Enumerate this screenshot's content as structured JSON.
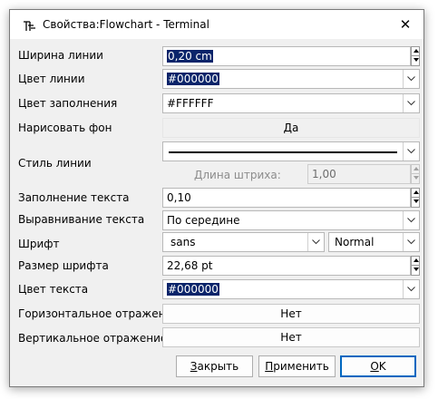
{
  "window": {
    "title": "Свойства:Flowchart - Terminal",
    "close_glyph": "✕"
  },
  "labels": {
    "line_width": "Ширина линии",
    "line_color": "Цвет линии",
    "fill_color": "Цвет заполнения",
    "draw_background": "Нарисовать фон",
    "line_style": "Стиль линии",
    "dash_length": "Длина штриха:",
    "text_padding": "Заполнение текста",
    "text_alignment": "Выравнивание текста",
    "font": "Шрифт",
    "font_size": "Размер шрифта",
    "text_color": "Цвет текста",
    "flip_horizontal": "Горизонтальное отражение",
    "flip_vertical": "Вертикальное отражение"
  },
  "values": {
    "line_width": "0,20 cm",
    "line_color": "#000000",
    "fill_color": "#FFFFFF",
    "draw_background": "Да",
    "dash_length": "1,00",
    "text_padding": "0,10",
    "text_alignment": "По середине",
    "font_family": "sans",
    "font_style": "Normal",
    "font_size": "22,68 pt",
    "text_color": "#000000",
    "flip_horizontal": "Нет",
    "flip_vertical": "Нет"
  },
  "buttons": {
    "close": {
      "accel": "З",
      "rest": "акрыть"
    },
    "apply": {
      "accel": "П",
      "rest": "рименить"
    },
    "ok": {
      "accel": "O",
      "rest": "K"
    }
  },
  "icons": [
    "app-icon",
    "close-icon",
    "chevron-down-icon",
    "spin-up-icon",
    "spin-down-icon"
  ]
}
